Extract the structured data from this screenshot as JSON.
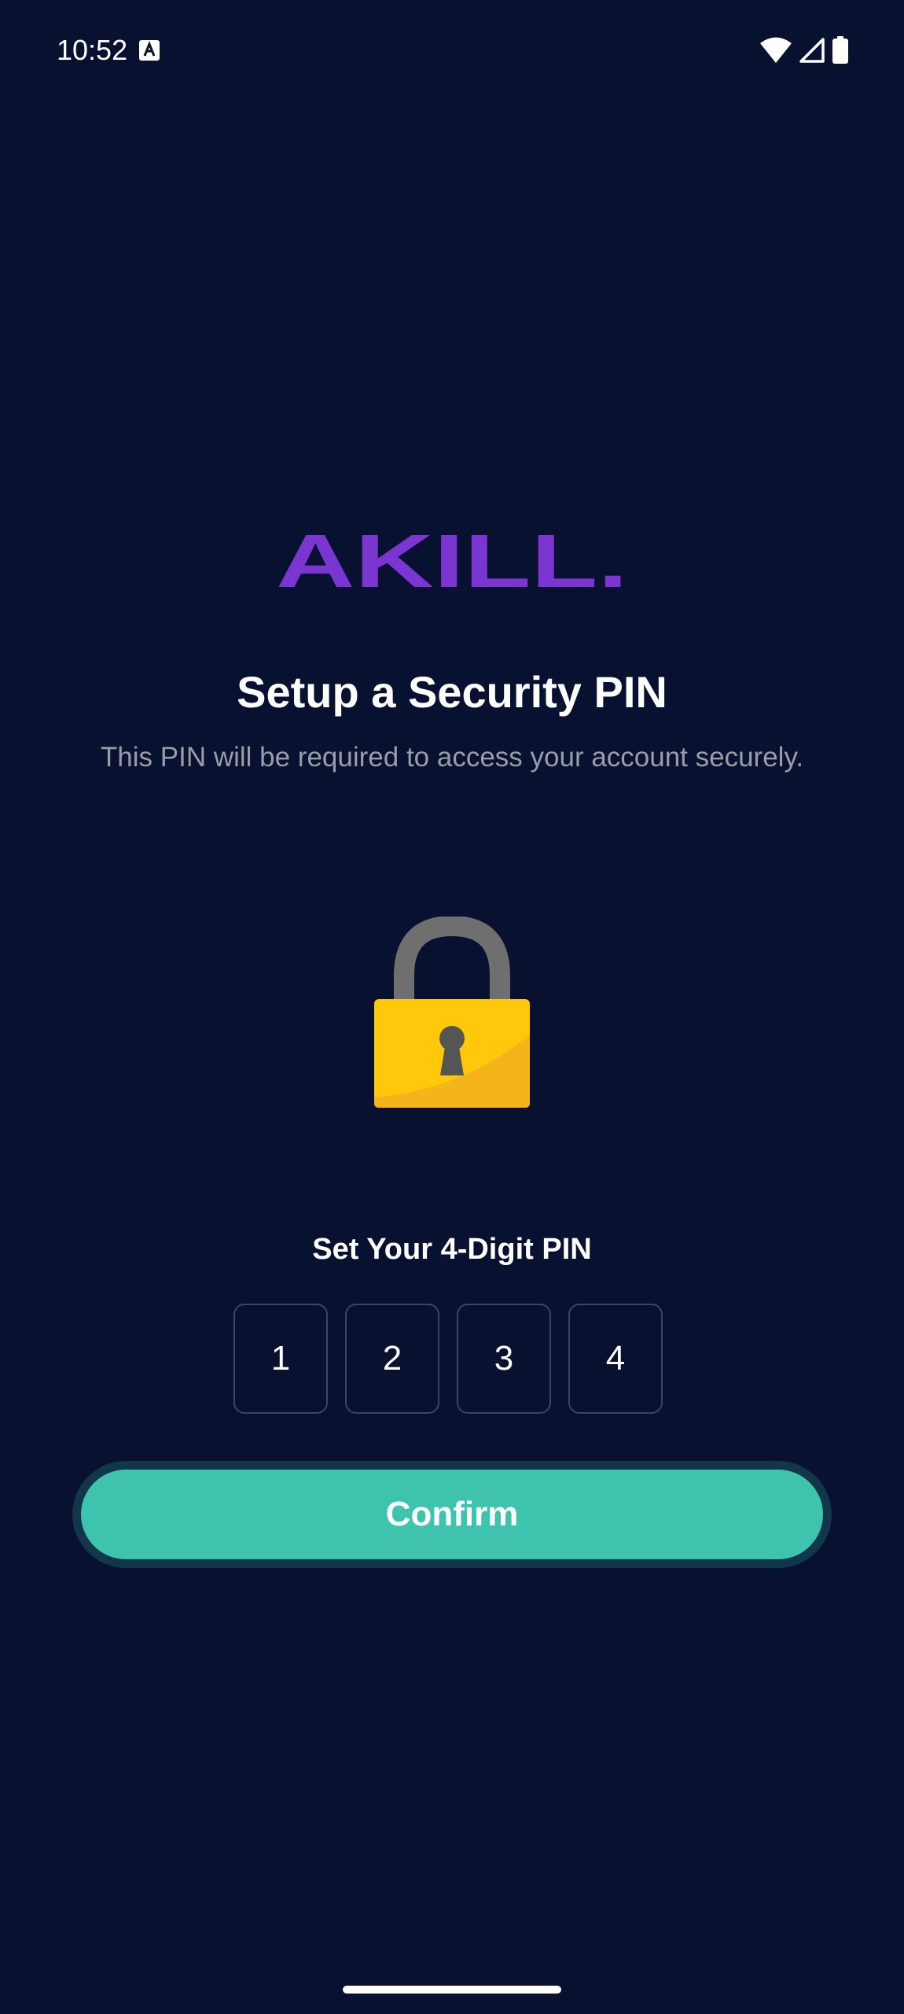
{
  "status_bar": {
    "time": "10:52"
  },
  "logo": {
    "text": "AKILL.",
    "color": "#7b35d0"
  },
  "header": {
    "title": "Setup a Security PIN",
    "subtitle": "This PIN will be required to access your account securely."
  },
  "pin": {
    "label": "Set Your 4-Digit PIN",
    "digits": [
      "1",
      "2",
      "3",
      "4"
    ]
  },
  "confirm_button": {
    "label": "Confirm"
  },
  "colors": {
    "background": "#081130",
    "accent": "#3ec3ae",
    "logo": "#7b35d0",
    "lock_body": "#ffc80a"
  }
}
